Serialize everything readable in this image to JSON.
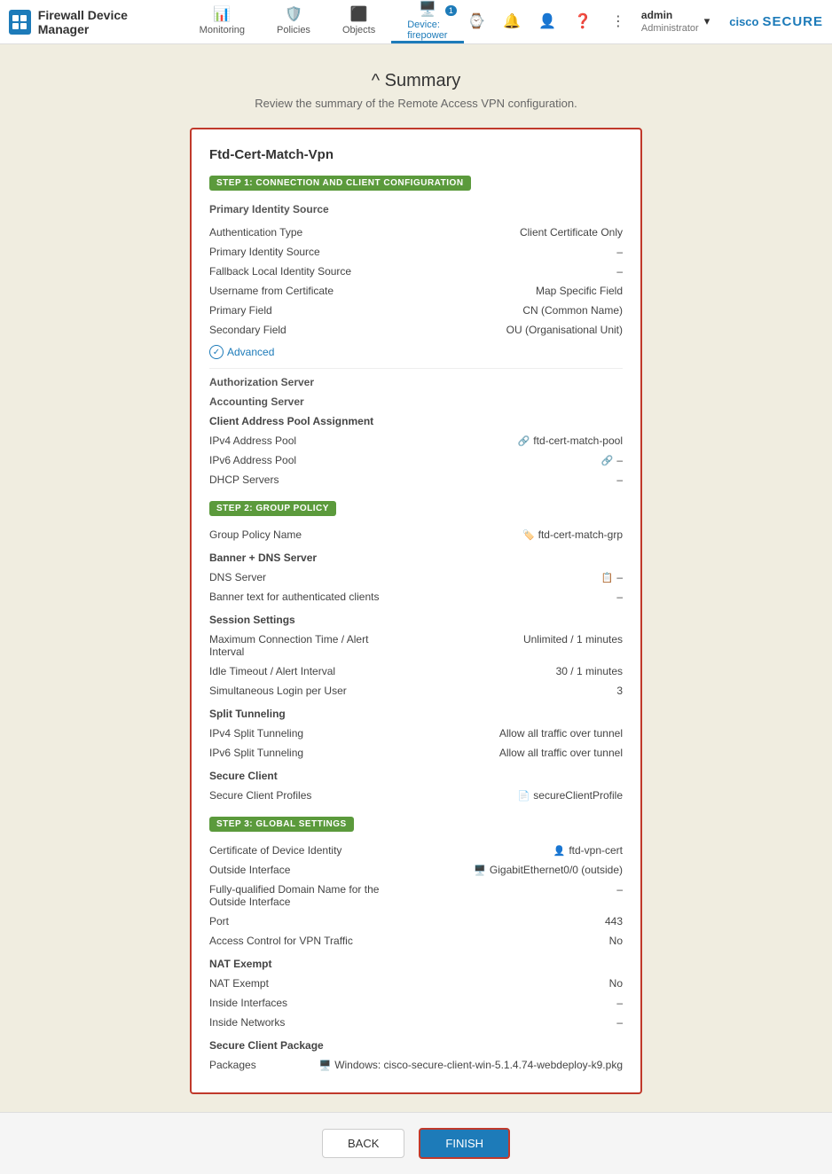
{
  "header": {
    "app_name": "Firewall Device Manager",
    "nav": [
      {
        "id": "monitoring",
        "label": "Monitoring",
        "icon": "📊",
        "active": false
      },
      {
        "id": "policies",
        "label": "Policies",
        "icon": "🛡️",
        "active": false
      },
      {
        "id": "objects",
        "label": "Objects",
        "icon": "⬛",
        "active": false
      },
      {
        "id": "device",
        "label": "Device: firepower",
        "icon": "🖥️",
        "active": true,
        "badge": "1"
      }
    ],
    "actions": [
      "⌚",
      "🔔",
      "👤",
      "❓",
      "⋮"
    ],
    "user": {
      "name": "admin",
      "role": "Administrator"
    },
    "cisco_label": "cisco",
    "secure_label": "SECURE"
  },
  "page": {
    "title": "^ Summary",
    "subtitle": "Review the summary of the Remote Access VPN configuration."
  },
  "summary": {
    "vpn_name": "Ftd-Cert-Match-Vpn",
    "step1": {
      "badge": "STEP 1: CONNECTION AND CLIENT CONFIGURATION",
      "primary_identity_source_label": "Primary Identity Source",
      "fields": [
        {
          "label": "Authentication Type",
          "value": "Client Certificate Only"
        },
        {
          "label": "Primary Identity Source",
          "value": "–"
        },
        {
          "label": "Fallback Local Identity Source",
          "value": "–"
        },
        {
          "label": "Username from Certificate",
          "value": "Map Specific Field"
        },
        {
          "label": "Primary Field",
          "value": "CN (Common Name)"
        },
        {
          "label": "Secondary Field",
          "value": "OU (Organisational Unit)"
        }
      ],
      "advanced_label": "Advanced",
      "authorization_server_label": "Authorization Server",
      "accounting_server_label": "Accounting Server",
      "client_address_label": "Client Address Pool Assignment",
      "address_fields": [
        {
          "label": "IPv4 Address Pool",
          "value": "ftd-cert-match-pool",
          "icon": true
        },
        {
          "label": "IPv6 Address Pool",
          "value": "–",
          "icon": true
        },
        {
          "label": "DHCP Servers",
          "value": "–"
        }
      ]
    },
    "step2": {
      "badge": "STEP 2: GROUP POLICY",
      "fields": [
        {
          "label": "Group Policy Name",
          "value": "ftd-cert-match-grp",
          "icon": true
        }
      ],
      "banner_dns_label": "Banner + DNS Server",
      "dns_fields": [
        {
          "label": "DNS Server",
          "value": "–",
          "icon": true
        },
        {
          "label": "Banner text for authenticated clients",
          "value": "–"
        }
      ],
      "session_label": "Session Settings",
      "session_fields": [
        {
          "label": "Maximum Connection Time / Alert Interval",
          "value": "Unlimited / 1 minutes"
        },
        {
          "label": "Idle Timeout / Alert Interval",
          "value": "30 / 1 minutes"
        },
        {
          "label": "Simultaneous Login per User",
          "value": "3"
        }
      ],
      "split_label": "Split Tunneling",
      "split_fields": [
        {
          "label": "IPv4 Split Tunneling",
          "value": "Allow all traffic over tunnel"
        },
        {
          "label": "IPv6 Split Tunneling",
          "value": "Allow all traffic over tunnel"
        }
      ],
      "secure_client_label": "Secure Client",
      "secure_client_fields": [
        {
          "label": "Secure Client Profiles",
          "value": "secureClientProfile",
          "icon": true
        }
      ]
    },
    "step3": {
      "badge": "STEP 3: GLOBAL SETTINGS",
      "fields": [
        {
          "label": "Certificate of Device Identity",
          "value": "ftd-vpn-cert",
          "icon": true
        },
        {
          "label": "Outside Interface",
          "value": "GigabitEthernet0/0 (outside)",
          "icon": true
        },
        {
          "label": "Fully-qualified Domain Name for the Outside Interface",
          "value": "–"
        },
        {
          "label": "Port",
          "value": "443"
        },
        {
          "label": "Access Control for VPN Traffic",
          "value": "No"
        }
      ],
      "nat_exempt_label": "NAT Exempt",
      "nat_fields": [
        {
          "label": "NAT Exempt",
          "value": "No"
        },
        {
          "label": "Inside Interfaces",
          "value": "–"
        },
        {
          "label": "Inside Networks",
          "value": "–"
        }
      ],
      "secure_pkg_label": "Secure Client Package",
      "package_fields": [
        {
          "label": "Packages",
          "value": "Windows: cisco-secure-client-win-5.1.4.74-webdeploy-k9.pkg",
          "icon": true
        }
      ]
    }
  },
  "footer": {
    "back_label": "BACK",
    "finish_label": "FINISH"
  }
}
